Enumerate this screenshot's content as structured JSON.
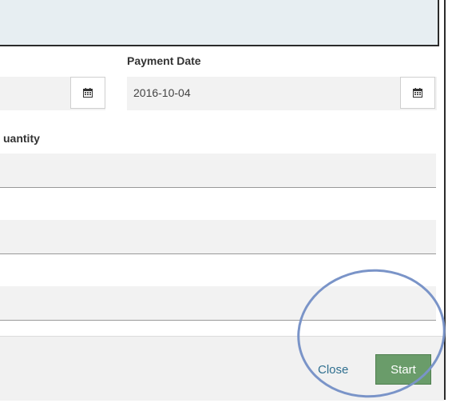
{
  "form": {
    "payment_date_label": "Payment Date",
    "payment_date_value": "2016-10-04",
    "quantity_label": "uantity"
  },
  "footer": {
    "close_label": "Close",
    "start_label": "Start"
  },
  "colors": {
    "header": "#e7eef2",
    "start_button": "#6a9c6a",
    "close_link": "#2f6f8f",
    "annotation": "#7a94c8"
  },
  "icons": {
    "calendar": "calendar-icon"
  }
}
